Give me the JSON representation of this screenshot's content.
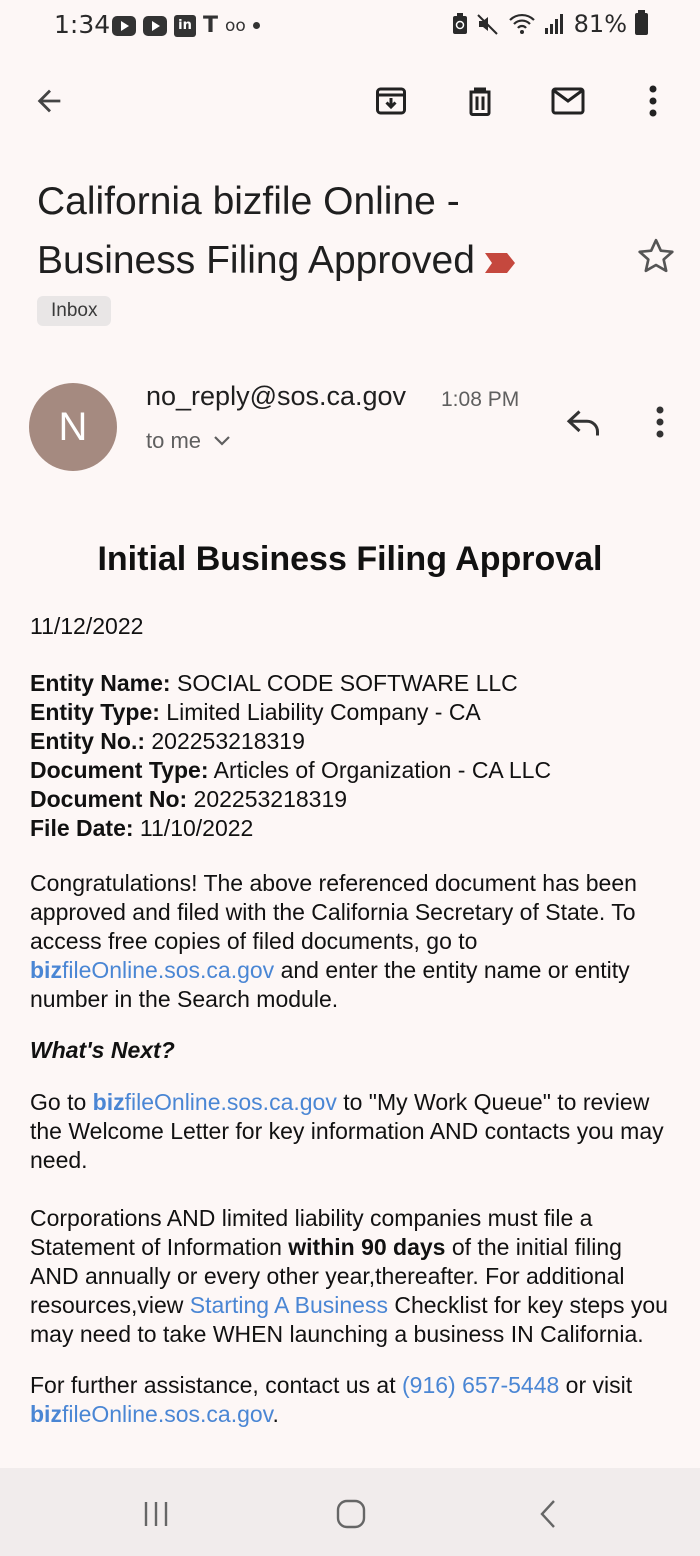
{
  "status_bar": {
    "time": "1:34",
    "battery_percent": "81%",
    "notification_icons": [
      "youtube-icon",
      "youtube-icon",
      "linkedin-icon",
      "tmobile-icon",
      "voicemail-icon",
      "dot-icon"
    ],
    "system_icons": [
      "battery-saver-icon",
      "mute-icon",
      "wifi-icon",
      "signal-icon",
      "battery-icon"
    ]
  },
  "toolbar": {
    "icons": [
      "back-arrow-icon",
      "archive-icon",
      "delete-icon",
      "mark-unread-icon",
      "more-vert-icon"
    ]
  },
  "email": {
    "subject": "California bizfile Online - Business Filing Approved",
    "label": "Inbox",
    "sender_initial": "N",
    "sender": "no_reply@sos.ca.gov",
    "time": "1:08 PM",
    "recipient": "to me",
    "heading": "Initial Business Filing Approval",
    "date": "11/12/2022",
    "fields": [
      {
        "label": "Entity Name:",
        "value": " SOCIAL CODE SOFTWARE LLC"
      },
      {
        "label": "Entity Type:",
        "value": " Limited Liability Company - CA"
      },
      {
        "label": "Entity No.:",
        "value": " 202253218319"
      },
      {
        "label": "Document Type:",
        "value": " Articles of Organization - CA LLC"
      },
      {
        "label": "Document No:",
        "value": " 202253218319"
      },
      {
        "label": "File Date:",
        "value": " 11/10/2022"
      }
    ],
    "para1_before": "Congratulations! The above referenced document has been approved and filed with the California Secretary of State. To access free copies of filed documents, go to ",
    "link_biz_bold": "biz",
    "link_biz_rest": "fileOnline.sos.ca.gov",
    "para1_after": " and enter the entity name or entity number in the Search module.",
    "whats_next": "What's Next?",
    "para2_before": "Go to ",
    "para2_after": " to \"My Work Queue\" to review the Welcome Letter for key information AND contacts you may need.",
    "para3_a": "Corporations AND limited liability companies must file a Statement of Information ",
    "para3_bold": "within 90 days",
    "para3_b": " of the initial filing AND annually or every other year,thereafter. For additional resources,view ",
    "para3_link": "Starting A Business",
    "para3_c": " Checklist for key steps you may need to take WHEN launching a business IN California.",
    "para4_a": "For further assistance, contact us at ",
    "para4_phone": "(916) 657-5448",
    "para4_b": " or visit ",
    "para4_end": "."
  },
  "colors": {
    "background": "#fdf7f6",
    "avatar": "#a58a80",
    "link": "#4a86d4",
    "important_marker": "#c5483e"
  },
  "nav_bar": {
    "icons": [
      "recent-apps-icon",
      "home-icon",
      "back-icon"
    ]
  }
}
